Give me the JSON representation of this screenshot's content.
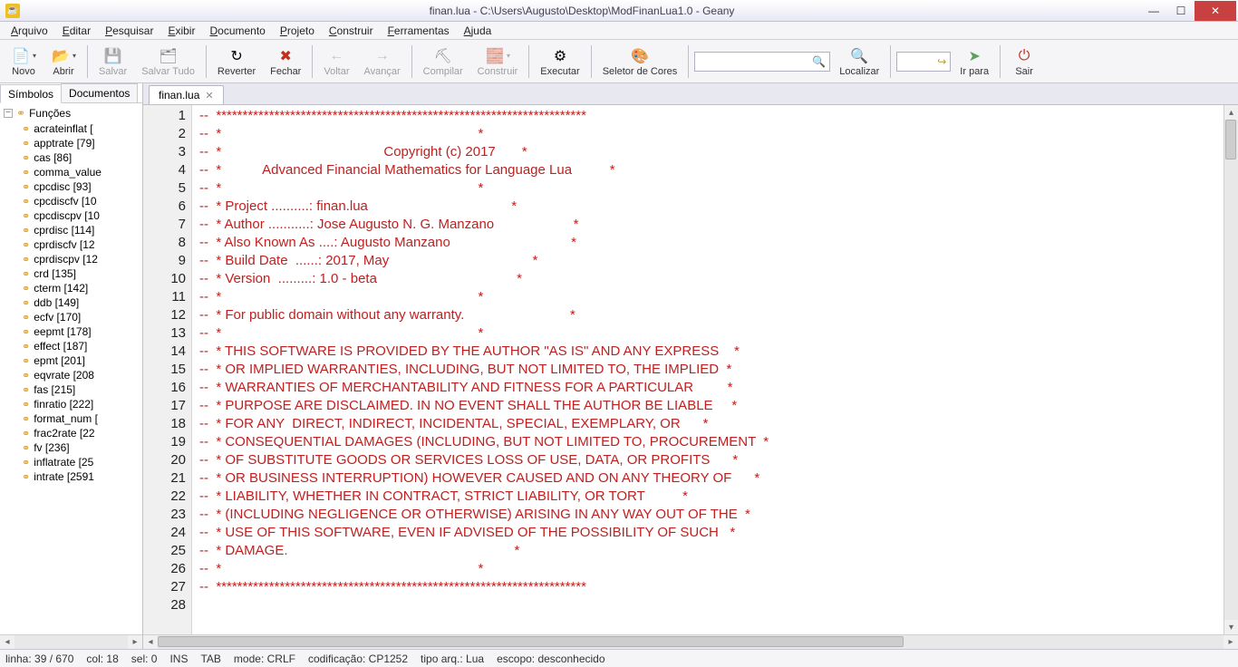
{
  "titlebar": {
    "title": "finan.lua - C:\\Users\\Augusto\\Desktop\\ModFinanLua1.0 - Geany"
  },
  "menu": {
    "items": [
      "Arquivo",
      "Editar",
      "Pesquisar",
      "Exibir",
      "Documento",
      "Projeto",
      "Construir",
      "Ferramentas",
      "Ajuda"
    ]
  },
  "toolbar": {
    "novo": "Novo",
    "abrir": "Abrir",
    "salvar": "Salvar",
    "salvar_tudo": "Salvar Tudo",
    "reverter": "Reverter",
    "fechar": "Fechar",
    "voltar": "Voltar",
    "avancar": "Avançar",
    "compilar": "Compilar",
    "construir": "Construir",
    "executar": "Executar",
    "seletor_cores": "Seletor de Cores",
    "localizar": "Localizar",
    "ir_para": "Ir para",
    "sair": "Sair"
  },
  "sidebar": {
    "tabs": {
      "simbolos": "Símbolos",
      "documentos": "Documentos"
    },
    "category": "Funções",
    "items": [
      "acrateinflat [",
      "apptrate [79]",
      "cas [86]",
      "comma_value",
      "cpcdisc [93]",
      "cpcdiscfv [10",
      "cpcdiscpv [10",
      "cprdisc [114]",
      "cprdiscfv [12",
      "cprdiscpv [12",
      "crd [135]",
      "cterm [142]",
      "ddb [149]",
      "ecfv [170]",
      "eepmt [178]",
      "effect [187]",
      "epmt [201]",
      "eqvrate [208",
      "fas [215]",
      "finratio [222]",
      "format_num [",
      "frac2rate [22",
      "fv [236]",
      "inflatrate [25",
      "intrate [2591"
    ]
  },
  "editor": {
    "tab_name": "finan.lua",
    "first_line": 1,
    "lines": [
      "--  **********************************************************************",
      "--  *                                                                    *",
      "--  *                                           Copyright (c) 2017       *",
      "--  *           Advanced Financial Mathematics for Language Lua          *",
      "--  *                                                                    *",
      "--  * Project ..........: finan.lua                                      *",
      "--  * Author ...........: Jose Augusto N. G. Manzano                     *",
      "--  * Also Known As ....: Augusto Manzano                                *",
      "--  * Build Date  ......: 2017, May                                      *",
      "--  * Version  .........: 1.0 - beta                                     *",
      "--  *                                                                    *",
      "--  * For public domain without any warranty.                            *",
      "--  *                                                                    *",
      "--  * THIS SOFTWARE IS PROVIDED BY THE AUTHOR \"AS IS\" AND ANY EXPRESS    *",
      "--  * OR IMPLIED WARRANTIES, INCLUDING, BUT NOT LIMITED TO, THE IMPLIED  *",
      "--  * WARRANTIES OF MERCHANTABILITY AND FITNESS FOR A PARTICULAR         *",
      "--  * PURPOSE ARE DISCLAIMED. IN NO EVENT SHALL THE AUTHOR BE LIABLE     *",
      "--  * FOR ANY  DIRECT, INDIRECT, INCIDENTAL, SPECIAL, EXEMPLARY, OR      *",
      "--  * CONSEQUENTIAL DAMAGES (INCLUDING, BUT NOT LIMITED TO, PROCUREMENT  *",
      "--  * OF SUBSTITUTE GOODS OR SERVICES LOSS OF USE, DATA, OR PROFITS      *",
      "--  * OR BUSINESS INTERRUPTION) HOWEVER CAUSED AND ON ANY THEORY OF      *",
      "--  * LIABILITY, WHETHER IN CONTRACT, STRICT LIABILITY, OR TORT          *",
      "--  * (INCLUDING NEGLIGENCE OR OTHERWISE) ARISING IN ANY WAY OUT OF THE  *",
      "--  * USE OF THIS SOFTWARE, EVEN IF ADVISED OF THE POSSIBILITY OF SUCH   *",
      "--  * DAMAGE.                                                            *",
      "--  *                                                                    *",
      "--  **********************************************************************",
      ""
    ]
  },
  "status": {
    "linha": "linha: 39 / 670",
    "col": "col: 18",
    "sel": "sel: 0",
    "ins": "INS",
    "tab": "TAB",
    "mode": "mode: CRLF",
    "enc": "codificação: CP1252",
    "ftype": "tipo arq.: Lua",
    "scope": "escopo: desconhecido"
  }
}
